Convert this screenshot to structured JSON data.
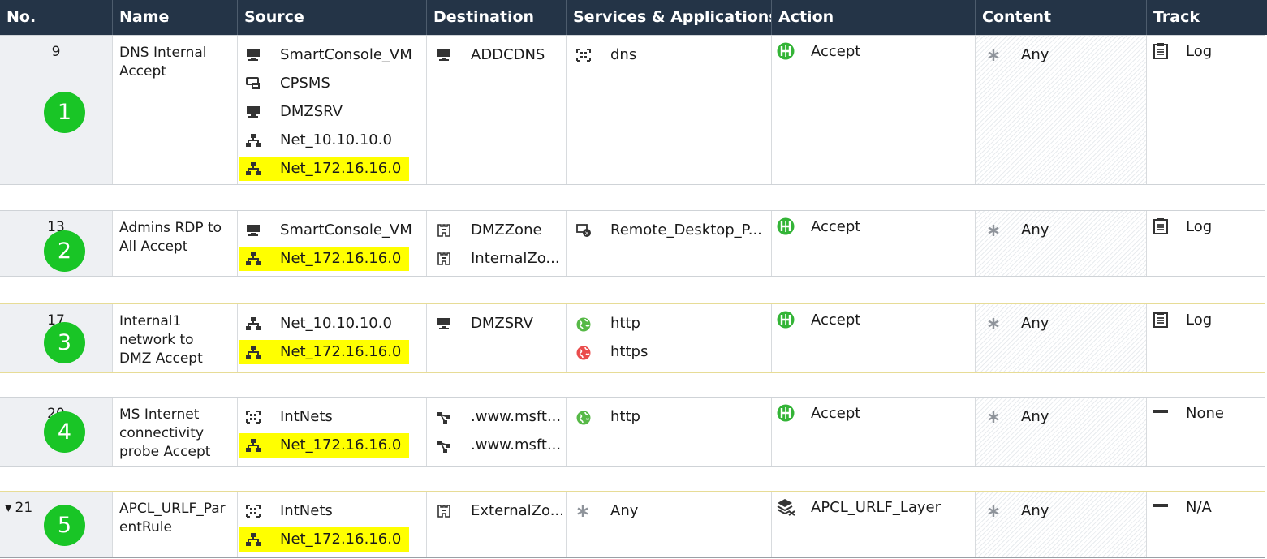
{
  "columns": {
    "no": "No.",
    "name": "Name",
    "source": "Source",
    "destination": "Destination",
    "services": "Services & Applications",
    "action": "Action",
    "content": "Content",
    "track": "Track"
  },
  "rules": [
    {
      "no": "9",
      "badge": "1",
      "name": [
        "DNS Internal",
        "Accept"
      ],
      "source": [
        {
          "icon": "computer-icon",
          "label": "SmartConsole_VM"
        },
        {
          "icon": "management-server-icon",
          "label": "CPSMS"
        },
        {
          "icon": "computer-icon",
          "label": "DMZSRV"
        },
        {
          "icon": "network-icon",
          "label": "Net_10.10.10.0"
        },
        {
          "icon": "network-icon",
          "label": "Net_172.16.16.0",
          "highlight": true
        }
      ],
      "destination": [
        {
          "icon": "computer-icon",
          "label": "ADDCDNS"
        }
      ],
      "services": [
        {
          "icon": "group-icon",
          "label": "dns"
        }
      ],
      "action": {
        "icon": "accept-icon",
        "label": "Accept"
      },
      "content": {
        "icon": "asterisk-icon",
        "label": "Any"
      },
      "track": {
        "icon": "log-icon",
        "label": "Log"
      }
    },
    {
      "no": "13",
      "badge": "2",
      "name": [
        "Admins RDP to",
        "All Accept"
      ],
      "source": [
        {
          "icon": "computer-icon",
          "label": "SmartConsole_VM"
        },
        {
          "icon": "network-icon",
          "label": "Net_172.16.16.0",
          "highlight": true
        }
      ],
      "destination": [
        {
          "icon": "zone-icon",
          "label": "DMZZone"
        },
        {
          "icon": "zone-icon",
          "label": "InternalZo..."
        }
      ],
      "services": [
        {
          "icon": "remote-desktop-icon",
          "label": "Remote_Desktop_P..."
        }
      ],
      "action": {
        "icon": "accept-icon",
        "label": "Accept"
      },
      "content": {
        "icon": "asterisk-icon",
        "label": "Any"
      },
      "track": {
        "icon": "log-icon",
        "label": "Log"
      }
    },
    {
      "no": "17",
      "badge": "3",
      "name": [
        "Internal1",
        "network to",
        "DMZ Accept"
      ],
      "source": [
        {
          "icon": "network-icon",
          "label": "Net_10.10.10.0"
        },
        {
          "icon": "network-icon",
          "label": "Net_172.16.16.0",
          "highlight": true
        }
      ],
      "destination": [
        {
          "icon": "computer-icon",
          "label": "DMZSRV"
        }
      ],
      "services": [
        {
          "icon": "globe-green-icon",
          "label": "http"
        },
        {
          "icon": "globe-red-icon",
          "label": "https"
        }
      ],
      "action": {
        "icon": "accept-icon",
        "label": "Accept"
      },
      "content": {
        "icon": "asterisk-icon",
        "label": "Any"
      },
      "track": {
        "icon": "log-icon",
        "label": "Log"
      }
    },
    {
      "no": "20",
      "badge": "4",
      "name": [
        "MS Internet",
        "connectivity",
        "probe Accept"
      ],
      "source": [
        {
          "icon": "group-icon",
          "label": "IntNets"
        },
        {
          "icon": "network-icon",
          "label": "Net_172.16.16.0",
          "highlight": true
        }
      ],
      "destination": [
        {
          "icon": "domain-icon",
          "label": ".www.msft..."
        },
        {
          "icon": "domain-icon",
          "label": ".www.msft..."
        }
      ],
      "services": [
        {
          "icon": "globe-green-icon",
          "label": "http"
        }
      ],
      "action": {
        "icon": "accept-icon",
        "label": "Accept"
      },
      "content": {
        "icon": "asterisk-icon",
        "label": "Any"
      },
      "track": {
        "icon": "dash-icon",
        "label": "None"
      }
    },
    {
      "no": "21",
      "expand": "▾",
      "badge": "5",
      "name": [
        "APCL_URLF_Par",
        "entRule"
      ],
      "source": [
        {
          "icon": "group-icon",
          "label": "IntNets"
        },
        {
          "icon": "network-icon",
          "label": "Net_172.16.16.0",
          "highlight": true
        }
      ],
      "destination": [
        {
          "icon": "zone-icon",
          "label": "ExternalZo..."
        }
      ],
      "services": [
        {
          "icon": "asterisk-icon",
          "label": "Any"
        }
      ],
      "action": {
        "icon": "layers-icon",
        "label": "APCL_URLF_Layer"
      },
      "content": {
        "icon": "asterisk-icon",
        "label": "Any"
      },
      "track": {
        "icon": "dash-icon",
        "label": "N/A"
      }
    }
  ]
}
